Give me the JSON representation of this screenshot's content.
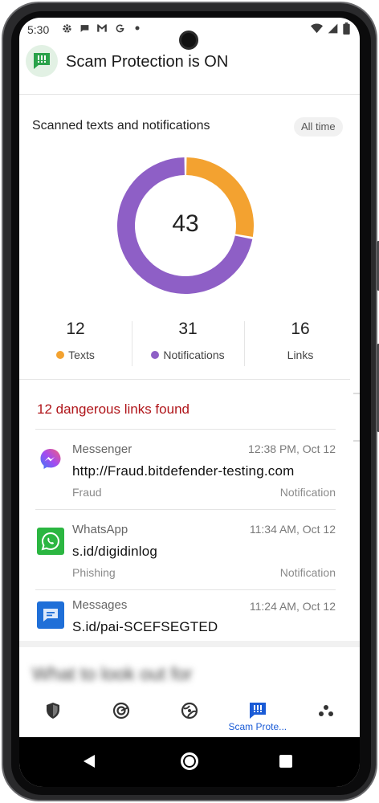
{
  "status_bar": {
    "time": "5:30",
    "left_icons": [
      "gear-icon",
      "chat-bubble-icon",
      "gmail-icon",
      "google-icon",
      "dot-icon"
    ],
    "right_icons": [
      "wifi-icon",
      "signal-icon",
      "battery-icon"
    ]
  },
  "header": {
    "title": "Scam Protection is ON",
    "badge_icon": "scam-protection-icon",
    "accent_color": "#2aa24a"
  },
  "summary": {
    "title": "Scanned texts and notifications",
    "filter_chip": "All time",
    "total": "43",
    "stats": [
      {
        "value": "12",
        "label": "Texts",
        "color": "#f3a230"
      },
      {
        "value": "31",
        "label": "Notifications",
        "color": "#8e5fc6"
      },
      {
        "value": "16",
        "label": "Links",
        "color": ""
      }
    ]
  },
  "chart_data": {
    "type": "pie",
    "categories": [
      "Texts",
      "Notifications"
    ],
    "values": [
      12,
      31
    ],
    "colors": [
      "#f3a230",
      "#8e5fc6"
    ],
    "center_label": "43",
    "title": "",
    "donut": true
  },
  "dangerous": {
    "heading": "12 dangerous links found",
    "color": "#b0151a",
    "items": [
      {
        "app": "Messenger",
        "icon": "messenger-icon",
        "time": "12:38 PM, Oct 12",
        "url": "http://Fraud.bitdefender-testing.com",
        "type": "Fraud",
        "source": "Notification"
      },
      {
        "app": "WhatsApp",
        "icon": "whatsapp-icon",
        "time": "11:34 AM, Oct 12",
        "url": "s.id/digidinlog",
        "type": "Phishing",
        "source": "Notification"
      },
      {
        "app": "Messages",
        "icon": "messages-icon",
        "time": "11:24 AM, Oct 12",
        "url": "S.id/pai-SCEFSEGTED",
        "type": "",
        "source": ""
      }
    ]
  },
  "next_section": {
    "heading": "What to look out for"
  },
  "bottom_nav": {
    "items": [
      {
        "icon": "shield-icon",
        "label": ""
      },
      {
        "icon": "target-icon",
        "label": ""
      },
      {
        "icon": "globe-icon",
        "label": ""
      },
      {
        "icon": "scam-protection-icon",
        "label": "Scam Prote...",
        "active": true
      },
      {
        "icon": "more-dots-icon",
        "label": ""
      }
    ],
    "active_color": "#1a5bd6"
  }
}
